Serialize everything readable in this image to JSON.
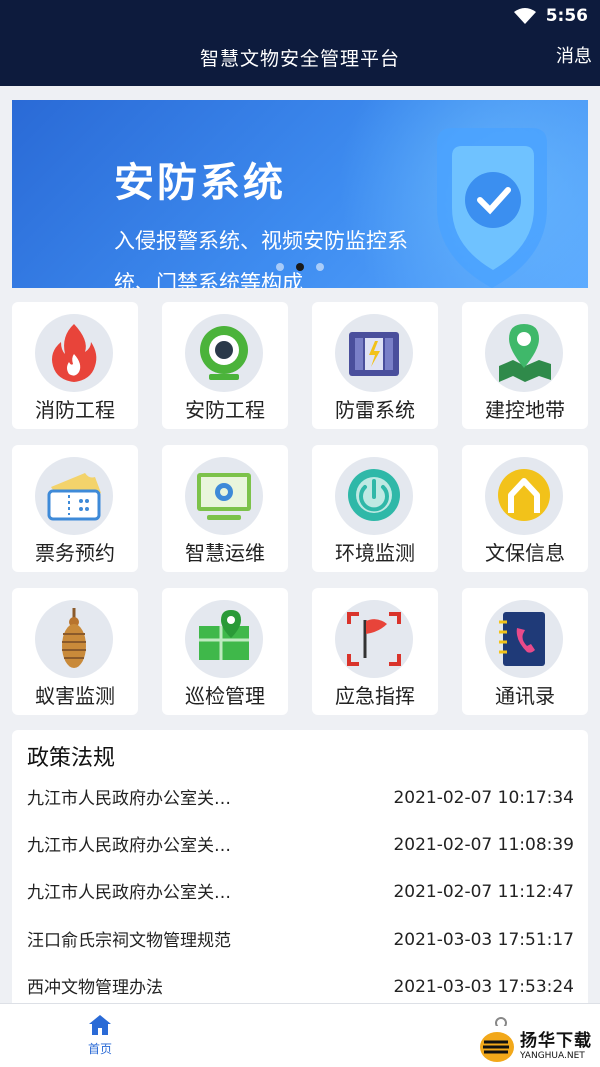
{
  "status": {
    "time": "5:56"
  },
  "header": {
    "title": "智慧文物安全管理平台",
    "message_label": "消息"
  },
  "banner": {
    "title": "安防系统",
    "desc": "入侵报警系统、视频安防监控系统、门禁系统等构成",
    "active_dot": 1
  },
  "grid": [
    {
      "label": "消防工程",
      "icon": "fire-icon"
    },
    {
      "label": "安防工程",
      "icon": "camera-icon"
    },
    {
      "label": "防雷系统",
      "icon": "lightning-icon"
    },
    {
      "label": "建控地带",
      "icon": "map-pin-icon"
    },
    {
      "label": "票务预约",
      "icon": "ticket-icon"
    },
    {
      "label": "智慧运维",
      "icon": "monitor-gear-icon"
    },
    {
      "label": "环境监测",
      "icon": "power-icon"
    },
    {
      "label": "文保信息",
      "icon": "arch-icon"
    },
    {
      "label": "蚁害监测",
      "icon": "termite-icon"
    },
    {
      "label": "巡检管理",
      "icon": "map-check-icon"
    },
    {
      "label": "应急指挥",
      "icon": "flag-icon"
    },
    {
      "label": "通讯录",
      "icon": "phone-book-icon"
    }
  ],
  "policy": {
    "title": "政策法规",
    "items": [
      {
        "title": "九江市人民政府办公室关…",
        "date": "2021-02-07 10:17:34"
      },
      {
        "title": "九江市人民政府办公室关…",
        "date": "2021-02-07 11:08:39"
      },
      {
        "title": "九江市人民政府办公室关…",
        "date": "2021-02-07 11:12:47"
      },
      {
        "title": "汪口俞氏宗祠文物管理规范",
        "date": "2021-03-03 17:51:17"
      },
      {
        "title": "西冲文物管理办法",
        "date": "2021-03-03 17:53:24"
      }
    ]
  },
  "nav": {
    "home_label": "首页"
  },
  "watermark": {
    "cn": "扬华下载",
    "en": "YANGHUA.NET"
  },
  "colors": {
    "header": "#0d1b3d",
    "accent": "#2a6ad6",
    "background": "#eef0f4"
  }
}
